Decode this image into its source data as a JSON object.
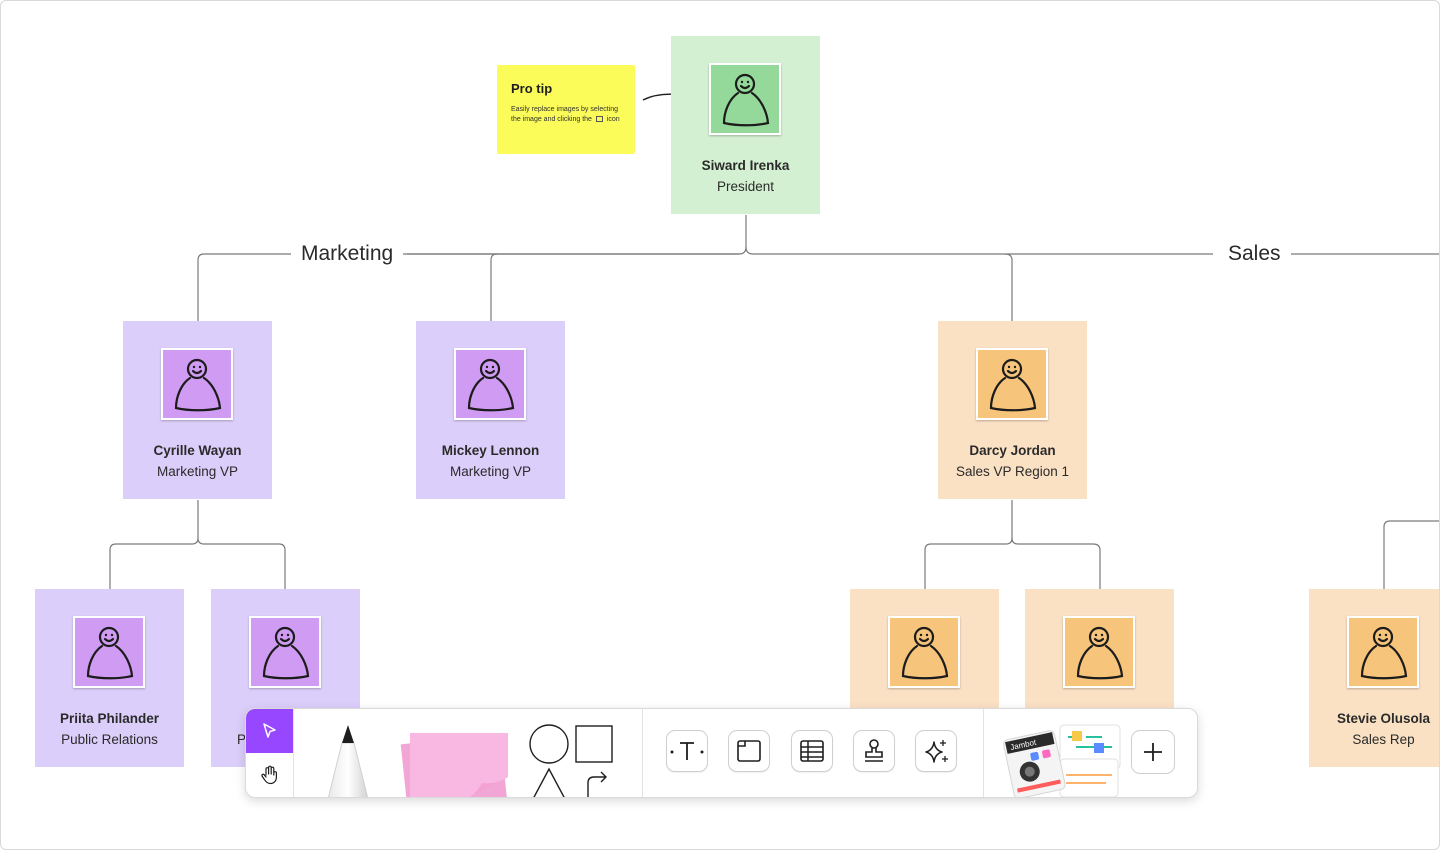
{
  "sections": {
    "marketing": "Marketing",
    "sales": "Sales"
  },
  "protip": {
    "title": "Pro tip",
    "body_before": "Easily replace images by selecting the image and clicking the",
    "body_after": "icon"
  },
  "people": {
    "president": {
      "name": "Siward Irenka",
      "role": "President"
    },
    "cyrille": {
      "name": "Cyrille Wayan",
      "role": "Marketing VP"
    },
    "mickey": {
      "name": "Mickey Lennon",
      "role": "Marketing VP"
    },
    "darcy": {
      "name": "Darcy Jordan",
      "role": "Sales VP Region 1"
    },
    "priita": {
      "name": "Priita Philander",
      "role": "Public Relations"
    },
    "partial": {
      "name": "P",
      "role": ""
    },
    "stevie": {
      "name": "Stevie Olusola",
      "role": "Sales Rep"
    }
  },
  "toolbar": {
    "tools": [
      "select-tool",
      "hand-tool",
      "pen-tool",
      "sticky-note-tool",
      "shape-tool",
      "text-tool",
      "section-tool",
      "table-tool",
      "stamp-tool",
      "ai-tool",
      "widgets-tool",
      "more-tool"
    ],
    "widget_thumb_label": "Jambot"
  },
  "colors": {
    "green_card": "#d4f0d2",
    "purple_card": "#dccefa",
    "orange_card": "#fbe1c4",
    "sticky_yellow": "#fbfb59",
    "accent": "#9747ff"
  }
}
